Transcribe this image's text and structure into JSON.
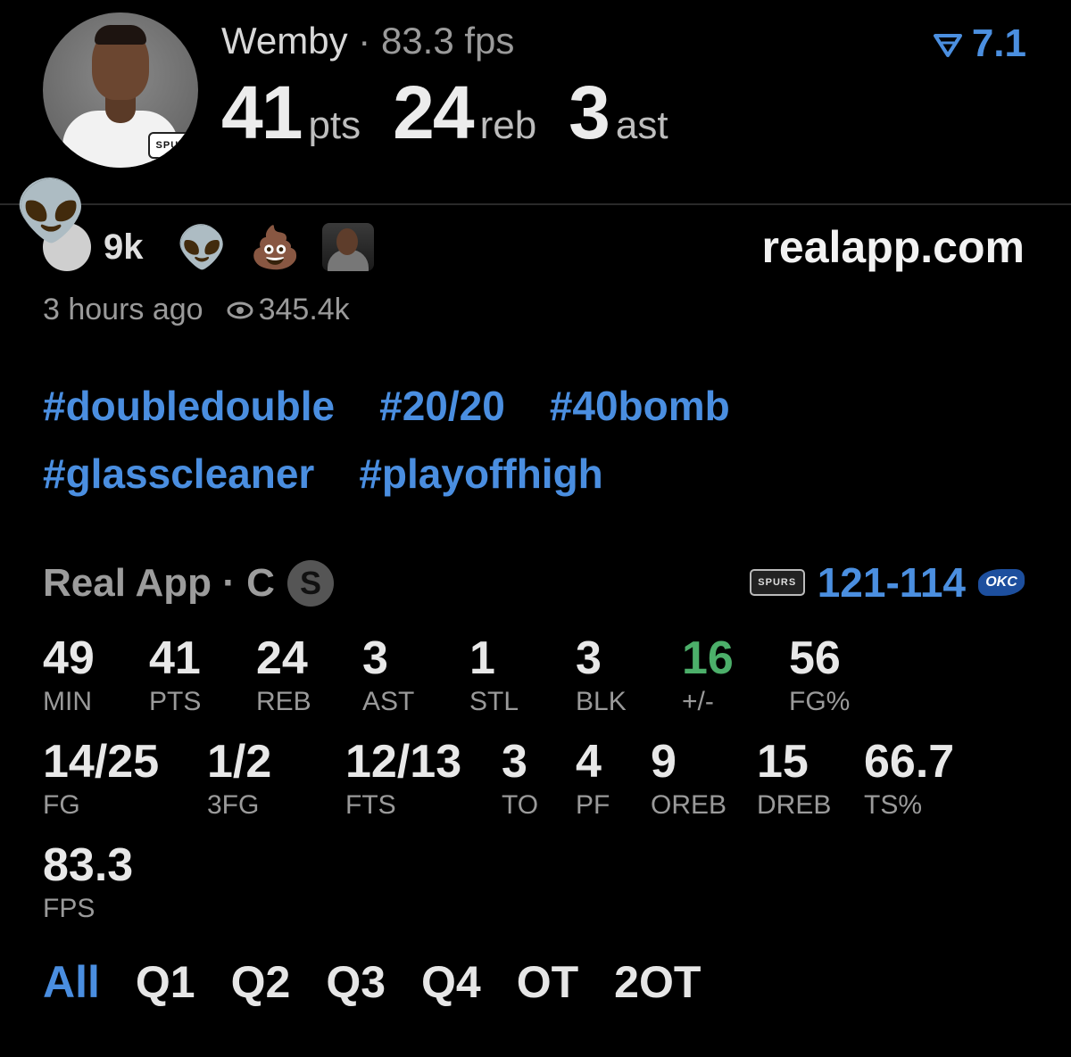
{
  "player": {
    "name": "Wemby",
    "separator": "·",
    "fps_text": "83.3 fps",
    "headline": [
      {
        "value": "41",
        "unit": "pts"
      },
      {
        "value": "24",
        "unit": "reb"
      },
      {
        "value": "3",
        "unit": "ast"
      }
    ],
    "team_logo_text": "SPURS"
  },
  "rating_badge": {
    "value": "7.1",
    "color": "#4b8fe0",
    "icon": "rating-chevron-icon"
  },
  "reactions": {
    "count": "9k",
    "items": [
      {
        "icon": "alien-emoji",
        "glyph": "👽"
      },
      {
        "icon": "poop-emoji",
        "glyph": "💩"
      },
      {
        "icon": "user-photo",
        "glyph": ""
      }
    ],
    "floating_glyph": "👽"
  },
  "site": "realapp.com",
  "meta": {
    "time": "3 hours ago",
    "views": "345.4k"
  },
  "tags": [
    "#doubledouble",
    "#20/20",
    "#40bomb",
    "#glasscleaner",
    "#playoffhigh"
  ],
  "game": {
    "source": "Real App · C",
    "position_badge": "S",
    "home_logo": "SPURS",
    "score": "121-114",
    "away_logo": "OKC"
  },
  "stats_row1": [
    {
      "v": "49",
      "l": "MIN"
    },
    {
      "v": "41",
      "l": "PTS"
    },
    {
      "v": "24",
      "l": "REB"
    },
    {
      "v": "3",
      "l": "AST"
    },
    {
      "v": "1",
      "l": "STL"
    },
    {
      "v": "3",
      "l": "BLK"
    },
    {
      "v": "16",
      "l": "+/-"
    },
    {
      "v": "56",
      "l": "FG%"
    }
  ],
  "stats_row2": [
    {
      "v": "14/25",
      "l": "FG"
    },
    {
      "v": "1/2",
      "l": "3FG"
    },
    {
      "v": "12/13",
      "l": "FTS"
    },
    {
      "v": "3",
      "l": "TO"
    },
    {
      "v": "4",
      "l": "PF"
    },
    {
      "v": "9",
      "l": "OREB"
    },
    {
      "v": "15",
      "l": "DREB"
    },
    {
      "v": "66.7",
      "l": "TS%"
    }
  ],
  "stats_row3": [
    {
      "v": "83.3",
      "l": "FPS"
    }
  ],
  "tabs": [
    "All",
    "Q1",
    "Q2",
    "Q3",
    "Q4",
    "OT",
    "2OT"
  ],
  "active_tab": "All",
  "colors": {
    "accent": "#4a8ee0",
    "positive": "#4caf6a",
    "background": "#000000"
  }
}
